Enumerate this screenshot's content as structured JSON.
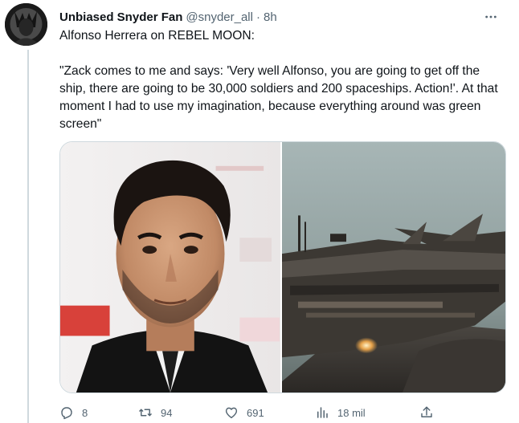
{
  "tweet": {
    "author": {
      "display_name": "Unbiased Snyder Fan",
      "handle": "@snyder_all",
      "separator": "·",
      "time": "8h"
    },
    "text": "Alfonso Herrera on REBEL MOON:\n\n\"Zack comes to me and says: 'Very well Alfonso, you are going to get off the ship, there are going to be 30,000 soldiers and 200 spaceships. Action!'. At that moment I had to use my imagination, because everything around was green screen\"",
    "more_icon": "more-dots-icon",
    "media": [
      {
        "icon": "portrait-photo"
      },
      {
        "icon": "spaceship-photo"
      }
    ],
    "actions": {
      "reply": {
        "icon": "reply-icon",
        "count": "8"
      },
      "retweet": {
        "icon": "retweet-icon",
        "count": "94"
      },
      "like": {
        "icon": "heart-icon",
        "count": "691"
      },
      "views": {
        "icon": "views-chart-icon",
        "count": "18 mil"
      },
      "share": {
        "icon": "share-icon"
      }
    }
  },
  "colors": {
    "text_primary": "#0f1419",
    "text_secondary": "#536471",
    "border": "#cfd9de",
    "background": "#ffffff"
  }
}
